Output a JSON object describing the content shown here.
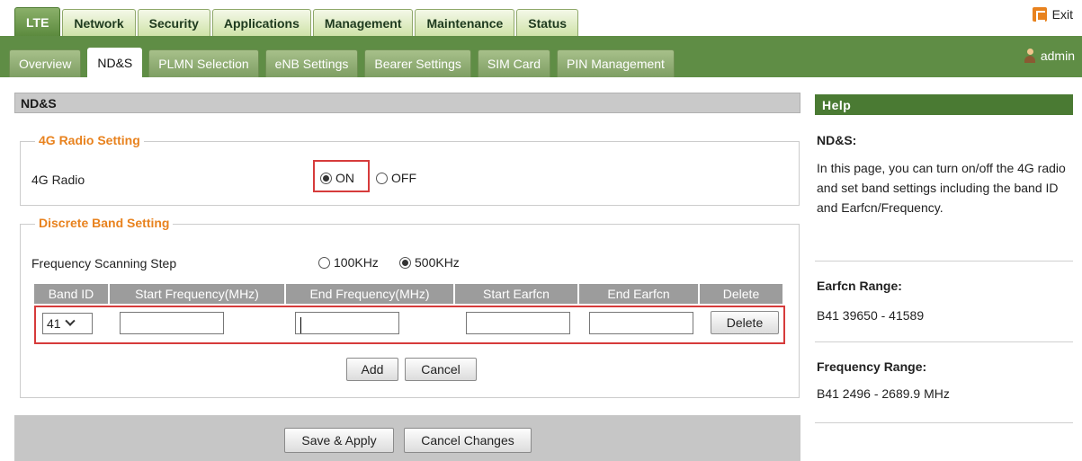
{
  "main_tabs": [
    {
      "label": "LTE",
      "active": true
    },
    {
      "label": "Network",
      "active": false
    },
    {
      "label": "Security",
      "active": false
    },
    {
      "label": "Applications",
      "active": false
    },
    {
      "label": "Management",
      "active": false
    },
    {
      "label": "Maintenance",
      "active": false
    },
    {
      "label": "Status",
      "active": false
    }
  ],
  "exit_label": "Exit",
  "sub_tabs": [
    {
      "label": "Overview",
      "active": false
    },
    {
      "label": "ND&S",
      "active": true
    },
    {
      "label": "PLMN Selection",
      "active": false
    },
    {
      "label": "eNB Settings",
      "active": false
    },
    {
      "label": "Bearer Settings",
      "active": false
    },
    {
      "label": "SIM Card",
      "active": false
    },
    {
      "label": "PIN Management",
      "active": false
    }
  ],
  "user_label": "admin",
  "panel_title": "ND&S",
  "radio_section": {
    "legend": "4G Radio Setting",
    "label": "4G Radio",
    "on_label": "ON",
    "off_label": "OFF",
    "selected": "ON"
  },
  "band_section": {
    "legend": "Discrete Band Setting",
    "step_label": "Frequency Scanning Step",
    "step_options": [
      "100KHz",
      "500KHz"
    ],
    "step_selected": "500KHz",
    "columns": [
      "Band ID",
      "Start Frequency(MHz)",
      "End Frequency(MHz)",
      "Start Earfcn",
      "End Earfcn",
      "Delete"
    ],
    "row": {
      "band_id": "41",
      "start_freq": "",
      "end_freq": "",
      "start_earfcn": "",
      "end_earfcn": "",
      "delete_label": "Delete"
    },
    "add_label": "Add",
    "cancel_label": "Cancel"
  },
  "footer": {
    "save_label": "Save & Apply",
    "cancel_changes_label": "Cancel Changes"
  },
  "help": {
    "header": "Help",
    "nds_title": "ND&S:",
    "nds_text": "In this page, you can turn on/off the 4G radio and set band settings including the band ID and Earfcn/Frequency.",
    "earfcn_title": "Earfcn Range:",
    "earfcn_text": "B41 39650 - 41589",
    "freq_title": "Frequency Range:",
    "freq_text": "B41 2496 - 2689.9 MHz"
  },
  "colors": {
    "accent_orange": "#e8821e",
    "tab_green": "#5f8d45",
    "help_green": "#4a7a33",
    "highlight_red": "#d63b3b"
  }
}
